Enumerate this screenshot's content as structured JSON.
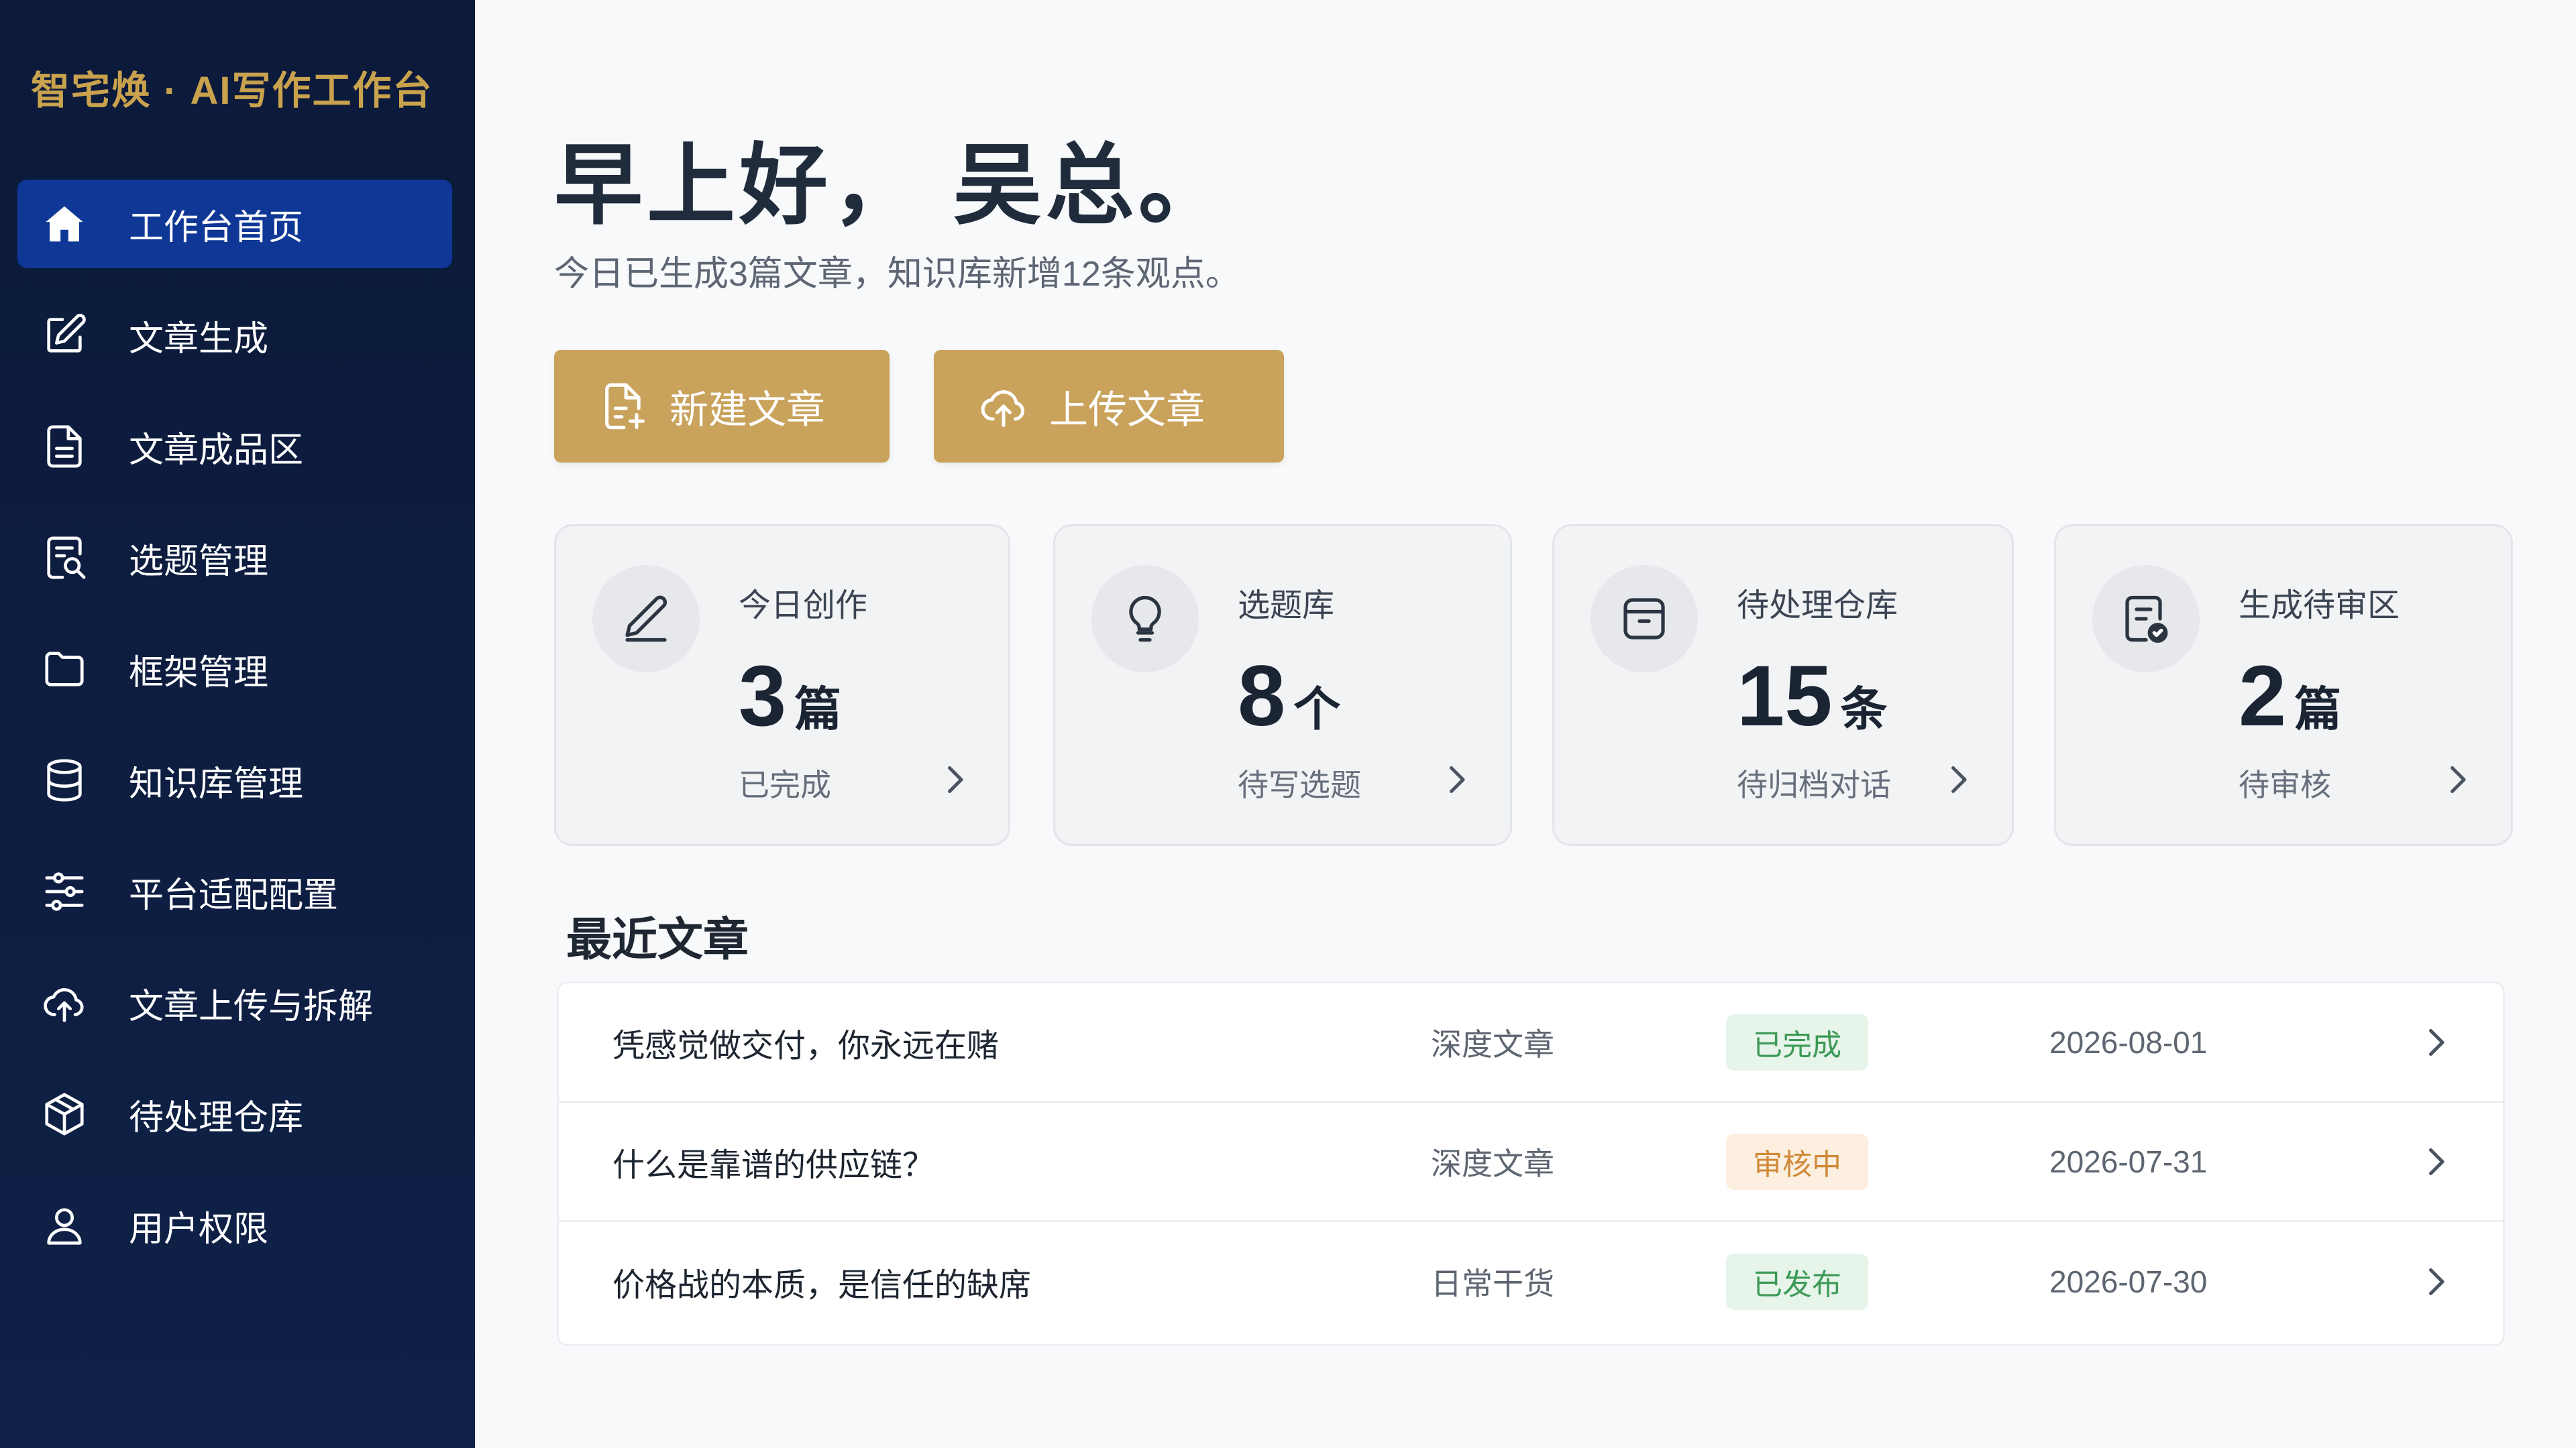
{
  "app": {
    "brand": "智宅焕 · AI写作工作台"
  },
  "sidebar": {
    "items": [
      {
        "label": "工作台首页",
        "icon": "home-icon",
        "active": true
      },
      {
        "label": "文章生成",
        "icon": "edit-icon"
      },
      {
        "label": "文章成品区",
        "icon": "document-icon"
      },
      {
        "label": "选题管理",
        "icon": "search-document-icon"
      },
      {
        "label": "框架管理",
        "icon": "folder-icon"
      },
      {
        "label": "知识库管理",
        "icon": "database-icon"
      },
      {
        "label": "平台适配配置",
        "icon": "sliders-icon"
      },
      {
        "label": "文章上传与拆解",
        "icon": "cloud-upload-icon"
      },
      {
        "label": "待处理仓库",
        "icon": "box-icon"
      },
      {
        "label": "用户权限",
        "icon": "user-icon"
      }
    ]
  },
  "main": {
    "greeting": "早上好，  吴总。",
    "subtitle": "今日已生成3篇文章，知识库新增12条观点。",
    "buttons": {
      "new_article": "新建文章",
      "upload_article": "上传文章"
    },
    "cards": [
      {
        "title": "今日创作",
        "value": "3",
        "unit": "篇",
        "desc": "已完成",
        "icon": "pen-icon"
      },
      {
        "title": "选题库",
        "value": "8",
        "unit": "个",
        "desc": "待写选题",
        "icon": "lightbulb-icon"
      },
      {
        "title": "待处理仓库",
        "value": "15",
        "unit": "条",
        "desc": "待归档对话",
        "icon": "archive-icon"
      },
      {
        "title": "生成待审区",
        "value": "2",
        "unit": "篇",
        "desc": "待审核",
        "icon": "review-document-icon"
      }
    ],
    "recent": {
      "title": "最近文章",
      "rows": [
        {
          "title": "凭感觉做交付，你永远在赌",
          "category": "深度文章",
          "status": "已完成",
          "date": "2026-08-01"
        },
        {
          "title": "什么是靠谱的供应链？",
          "category": "深度文章",
          "status": "审核中",
          "date": "2026-07-31"
        },
        {
          "title": "价格战的本质，是信任的缺席",
          "category": "日常干货",
          "status": "已发布",
          "date": "2026-07-30"
        }
      ]
    }
  },
  "colors": {
    "sidebar_bg": "#0c1a3a",
    "sidebar_active": "#0f3796",
    "brand_gold": "#c9a24e",
    "button_gold": "#c9a25c",
    "status_done_bg": "#e6f4ea",
    "status_done_fg": "#3c9a55",
    "status_review_bg": "#fcefdf",
    "status_review_fg": "#d08a3a"
  }
}
